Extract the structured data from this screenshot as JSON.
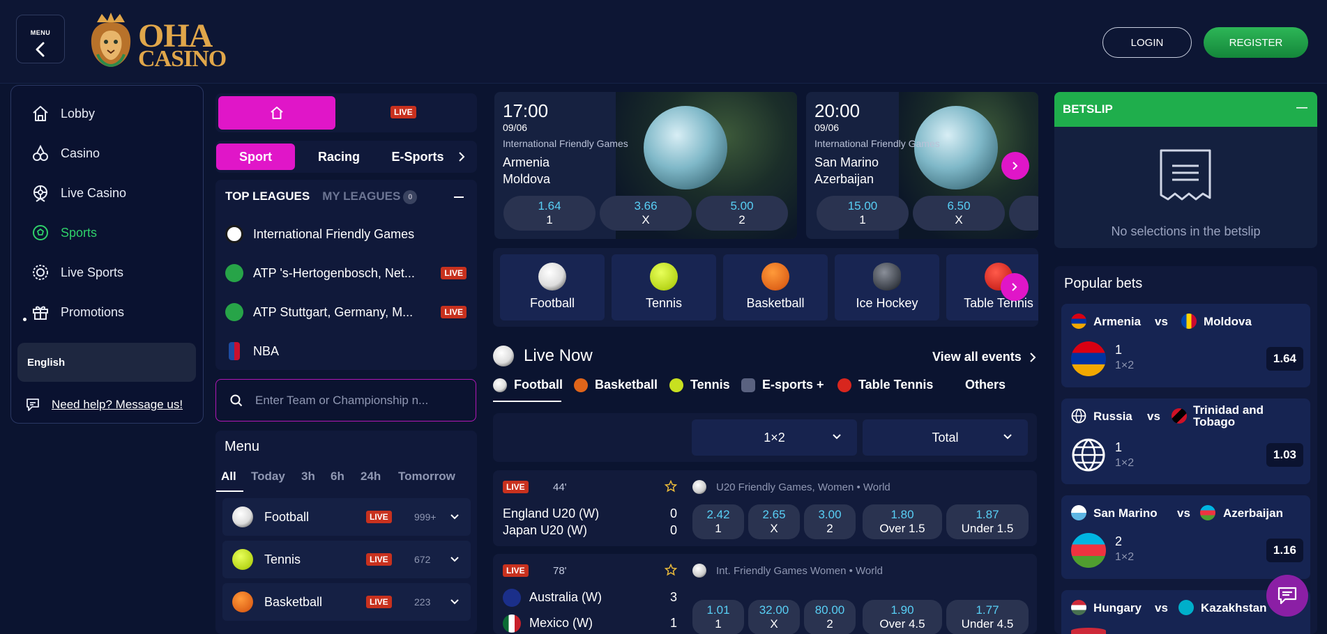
{
  "header": {
    "menu_label": "MENU",
    "logo_line1": "OHA",
    "logo_line2": "CASINO",
    "login": "LOGIN",
    "register": "REGISTER"
  },
  "sidebar": {
    "items": [
      {
        "label": "Lobby",
        "icon": "home-icon"
      },
      {
        "label": "Casino",
        "icon": "cards-icon"
      },
      {
        "label": "Live Casino",
        "icon": "roulette-icon"
      },
      {
        "label": "Sports",
        "icon": "soccer-ball-icon",
        "active": true
      },
      {
        "label": "Live Sports",
        "icon": "live-target-icon"
      },
      {
        "label": "Promotions",
        "icon": "gift-icon"
      }
    ],
    "language": "English",
    "help": "Need help? Message us!"
  },
  "top_tabs": {
    "live": "LIVE"
  },
  "sport_tabs": [
    "Sport",
    "Racing",
    "E-Sports"
  ],
  "leagues": {
    "top_label": "TOP LEAGUES",
    "my_label": "MY LEAGUES",
    "my_count": "0",
    "rows": [
      {
        "name": "International Friendly Games",
        "live": ""
      },
      {
        "name": "ATP 's-Hertogenbosch, Net...",
        "live": "LIVE"
      },
      {
        "name": "ATP Stuttgart, Germany, M...",
        "live": "LIVE"
      },
      {
        "name": "NBA",
        "live": ""
      }
    ]
  },
  "search": {
    "placeholder": "Enter Team or Championship n..."
  },
  "menu": {
    "title": "Menu",
    "filters": [
      "All",
      "Today",
      "3h",
      "6h",
      "24h",
      "Tomorrow"
    ],
    "sports": [
      {
        "name": "Football",
        "live": "LIVE",
        "count": "999+"
      },
      {
        "name": "Tennis",
        "live": "LIVE",
        "count": "672"
      },
      {
        "name": "Basketball",
        "live": "LIVE",
        "count": "223"
      }
    ]
  },
  "featured": [
    {
      "time": "17:00",
      "date": "09/06",
      "league": "International Friendly Games",
      "home": "Armenia",
      "away": "Moldova",
      "odds": [
        {
          "v": "1.64",
          "l": "1"
        },
        {
          "v": "3.66",
          "l": "X"
        },
        {
          "v": "5.00",
          "l": "2"
        }
      ]
    },
    {
      "time": "20:00",
      "date": "09/06",
      "league": "International Friendly Games",
      "home": "San Marino",
      "away": "Azerbaijan",
      "odds": [
        {
          "v": "15.00",
          "l": "1"
        },
        {
          "v": "6.50",
          "l": "X"
        }
      ]
    }
  ],
  "categories": [
    "Football",
    "Tennis",
    "Basketball",
    "Ice Hockey",
    "Table Tennis"
  ],
  "live_now": {
    "title": "Live Now",
    "view_all": "View all events",
    "tabs": [
      "Football",
      "Basketball",
      "Tennis",
      "E-sports +",
      "Table Tennis",
      "Others"
    ],
    "market1": "1×2",
    "market2": "Total",
    "events": [
      {
        "live": "LIVE",
        "minute": "44'",
        "competition": "U20 Friendly Games, Women • World",
        "home": "England U20 (W)",
        "away": "Japan U20 (W)",
        "home_score": "0",
        "away_score": "0",
        "odds": [
          {
            "v": "2.42",
            "l": "1"
          },
          {
            "v": "2.65",
            "l": "X"
          },
          {
            "v": "3.00",
            "l": "2"
          },
          {
            "v": "1.80",
            "l": "Over 1.5"
          },
          {
            "v": "1.87",
            "l": "Under 1.5"
          }
        ]
      },
      {
        "live": "LIVE",
        "minute": "78'",
        "competition": "Int. Friendly Games Women • World",
        "home": "Australia (W)",
        "away": "Mexico (W)",
        "home_score": "3",
        "away_score": "1",
        "odds": [
          {
            "v": "1.01",
            "l": "1"
          },
          {
            "v": "32.00",
            "l": "X"
          },
          {
            "v": "80.00",
            "l": "2"
          },
          {
            "v": "1.90",
            "l": "Over 4.5"
          },
          {
            "v": "1.77",
            "l": "Under 4.5"
          }
        ]
      }
    ]
  },
  "betslip": {
    "title": "BETSLIP",
    "collapse": "—",
    "empty": "No selections in the betslip"
  },
  "popular": {
    "title": "Popular bets",
    "vs": "vs",
    "items": [
      {
        "home": "Armenia",
        "away": "Moldova",
        "pick": "1",
        "market": "1×2",
        "odds": "1.64"
      },
      {
        "home": "Russia",
        "away": "Trinidad and Tobago",
        "pick": "1",
        "market": "1×2",
        "odds": "1.03"
      },
      {
        "home": "San Marino",
        "away": "Azerbaijan",
        "pick": "2",
        "market": "1×2",
        "odds": "1.16"
      },
      {
        "home": "Hungary",
        "away": "Kazakhstan"
      }
    ]
  },
  "colors": {
    "accent_pink": "#e016c8",
    "green": "#1fae4c",
    "live_red": "#c8311e",
    "odds_blue": "#58cff5",
    "bg": "#0b1430"
  }
}
